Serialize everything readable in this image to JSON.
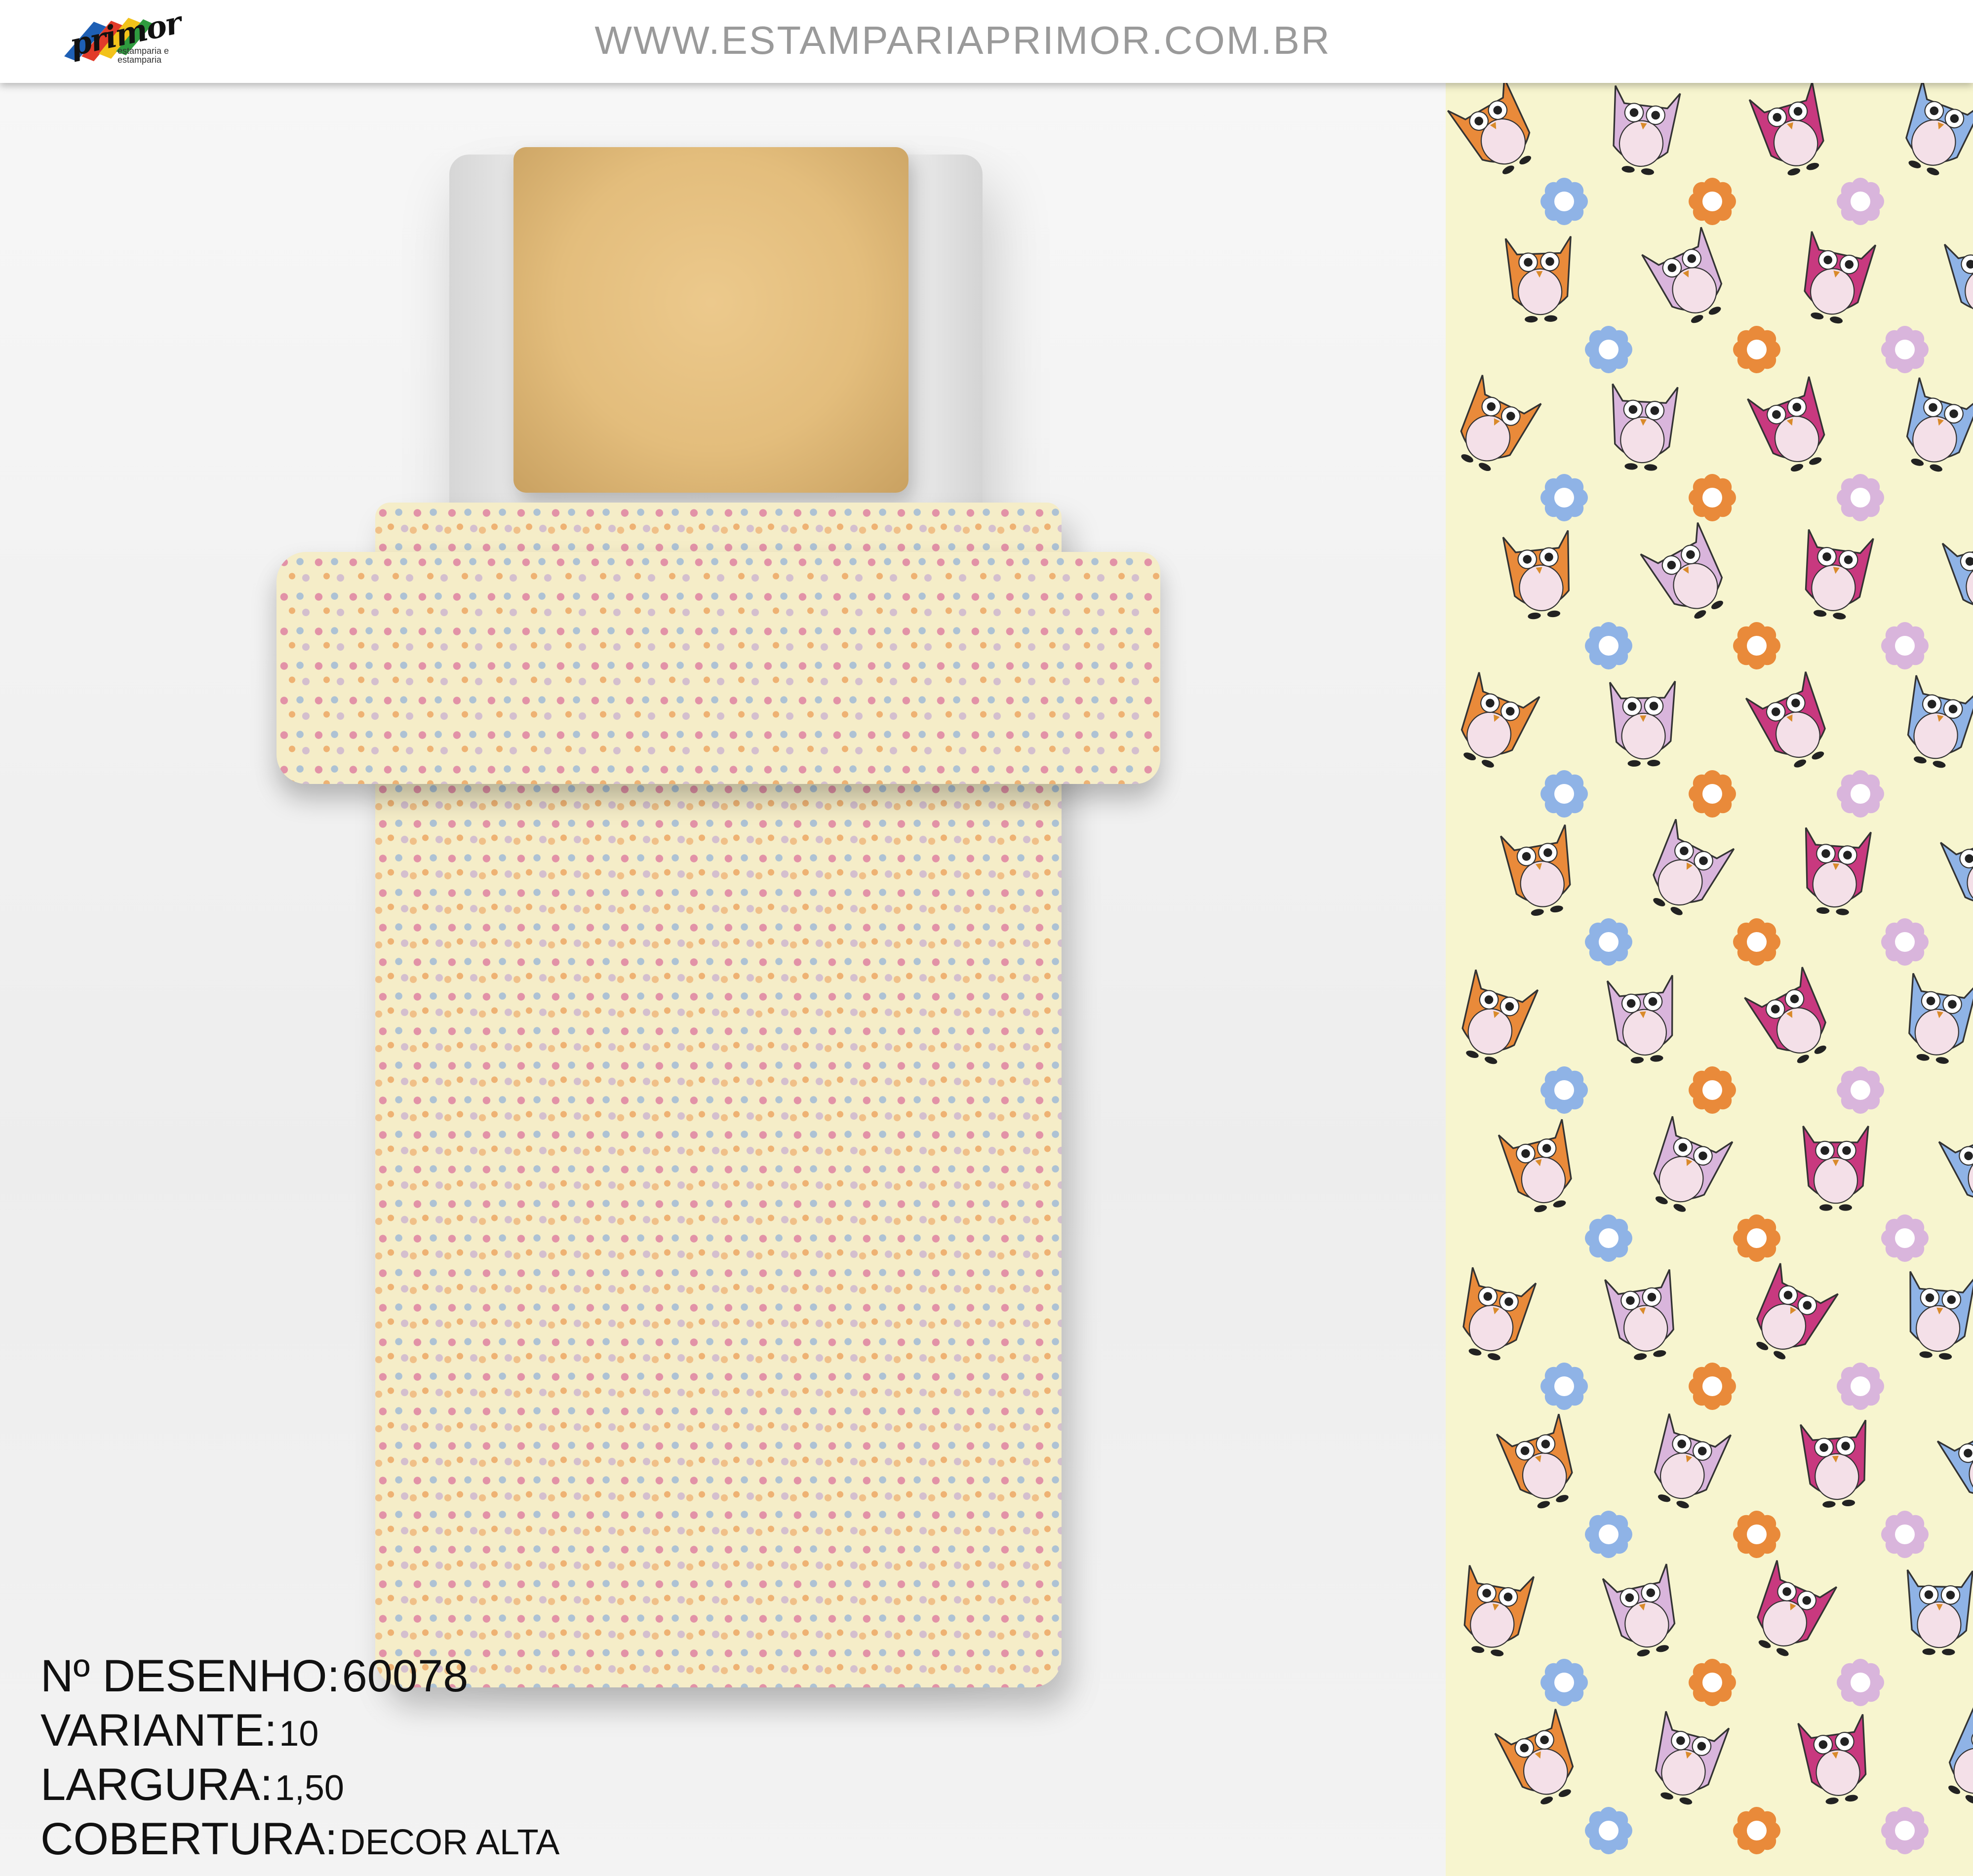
{
  "header": {
    "logo_text": "primor",
    "logo_sub": "estamparia e estamparia",
    "site_url": "WWW.ESTAMPARIAPRIMOR.COM.BR"
  },
  "info": {
    "design_label": "Nº DESENHO:",
    "design_value": "60078",
    "variant_label": "VARIANTE:",
    "variant_value": "10",
    "width_label": "LARGURA:",
    "width_value": "1,50",
    "coverage_label": "COBERTURA:",
    "coverage_value": "DECOR ALTA"
  },
  "colors": {
    "background": "#f7f5cf",
    "pink": "#c8397f",
    "orange": "#e98a3a",
    "blue": "#8fb3e6",
    "lilac": "#d9b5dc",
    "pillow": "#e3bd7c"
  },
  "icons": {
    "owl": "owl-icon",
    "flower": "flower-icon"
  }
}
